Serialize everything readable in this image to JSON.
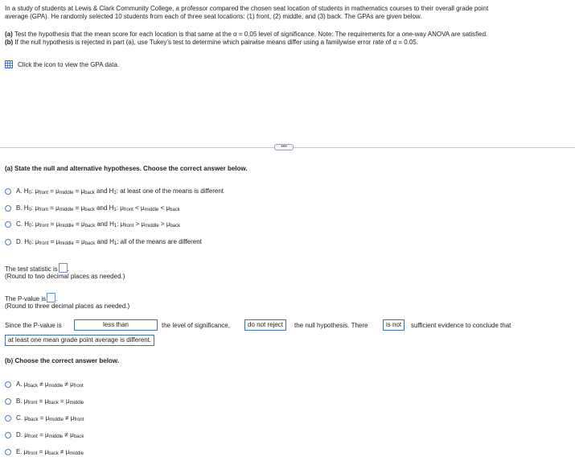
{
  "intro": {
    "line1": "In a study of students at Lewis & Clark Community College, a professor compared the chosen seat location of students in mathematics courses to their overall grade point",
    "line2": "average (GPA). He randomly selected 10 students from each of three seat locations: (1) front, (2) middle, and (3) back. The GPAs are given below."
  },
  "tasks": {
    "a_label": "(a)",
    "a_text": " Test the hypothesis that the mean score for each location is that same at the α = 0.05 level of significance. Note: The requirements for a one-way ANOVA are satisfied.",
    "b_label": "(b)",
    "b_text": " If the null hypothesis is rejected in part (a), use Tukey's test to determine which pairwise means differ using a familywise error rate of α = 0.05."
  },
  "data_link": {
    "icon": "table-grid-icon",
    "text": "Click the icon to view the GPA data."
  },
  "more_button": {
    "label": "•••"
  },
  "part_a": {
    "prompt": "(a) State the null and alternative hypotheses. Choose the correct answer below.",
    "options": [
      {
        "letter": "A.",
        "h1": "at least one of the means is different",
        "h1_type": "text"
      },
      {
        "letter": "B.",
        "h1_type": "ineq",
        "sym1": "<",
        "sym2": "<"
      },
      {
        "letter": "C.",
        "h1_type": "ineq",
        "sym1": ">",
        "sym2": ">"
      },
      {
        "letter": "D.",
        "h1": "all of the means are different",
        "h1_type": "text"
      }
    ],
    "and": "and",
    "h0_prefix": "H",
    "h0_sub": "0",
    "h1_prefix": "H",
    "h1_sub": "1",
    "mu": "μ",
    "front": "front",
    "middle": "middle",
    "back": "back",
    "eq": "=",
    "colon": ":"
  },
  "statistic": {
    "label": "The test statistic is",
    "hint": "(Round to two decimal places as needed.)"
  },
  "pvalue": {
    "label": "The P-value is",
    "hint": "(Round to three decimal places as needed.)"
  },
  "conclusion": {
    "since": "Since the P-value is",
    "comparison": "less than",
    "mid": "the level of significance,",
    "decision": "do not reject",
    "mid2": "the null hypothesis. There",
    "evidence": "is not",
    "tail": "sufficient evidence to conclude that",
    "claim": "at least one mean grade point average is different."
  },
  "part_b": {
    "prompt": "(b) Choose the correct answer below.",
    "options": [
      {
        "letter": "A.",
        "terms": [
          "back",
          "middle",
          "front"
        ],
        "ops": [
          "≠",
          "≠"
        ]
      },
      {
        "letter": "B.",
        "terms": [
          "front",
          "back",
          "middle"
        ],
        "ops": [
          "=",
          "="
        ]
      },
      {
        "letter": "C.",
        "terms": [
          "back",
          "middle",
          "front"
        ],
        "ops": [
          "=",
          "≠"
        ]
      },
      {
        "letter": "D.",
        "terms": [
          "front",
          "middle",
          "back"
        ],
        "ops": [
          "=",
          "≠"
        ]
      },
      {
        "letter": "E.",
        "terms": [
          "front",
          "back",
          "middle"
        ],
        "ops": [
          "=",
          "≠"
        ]
      }
    ]
  }
}
